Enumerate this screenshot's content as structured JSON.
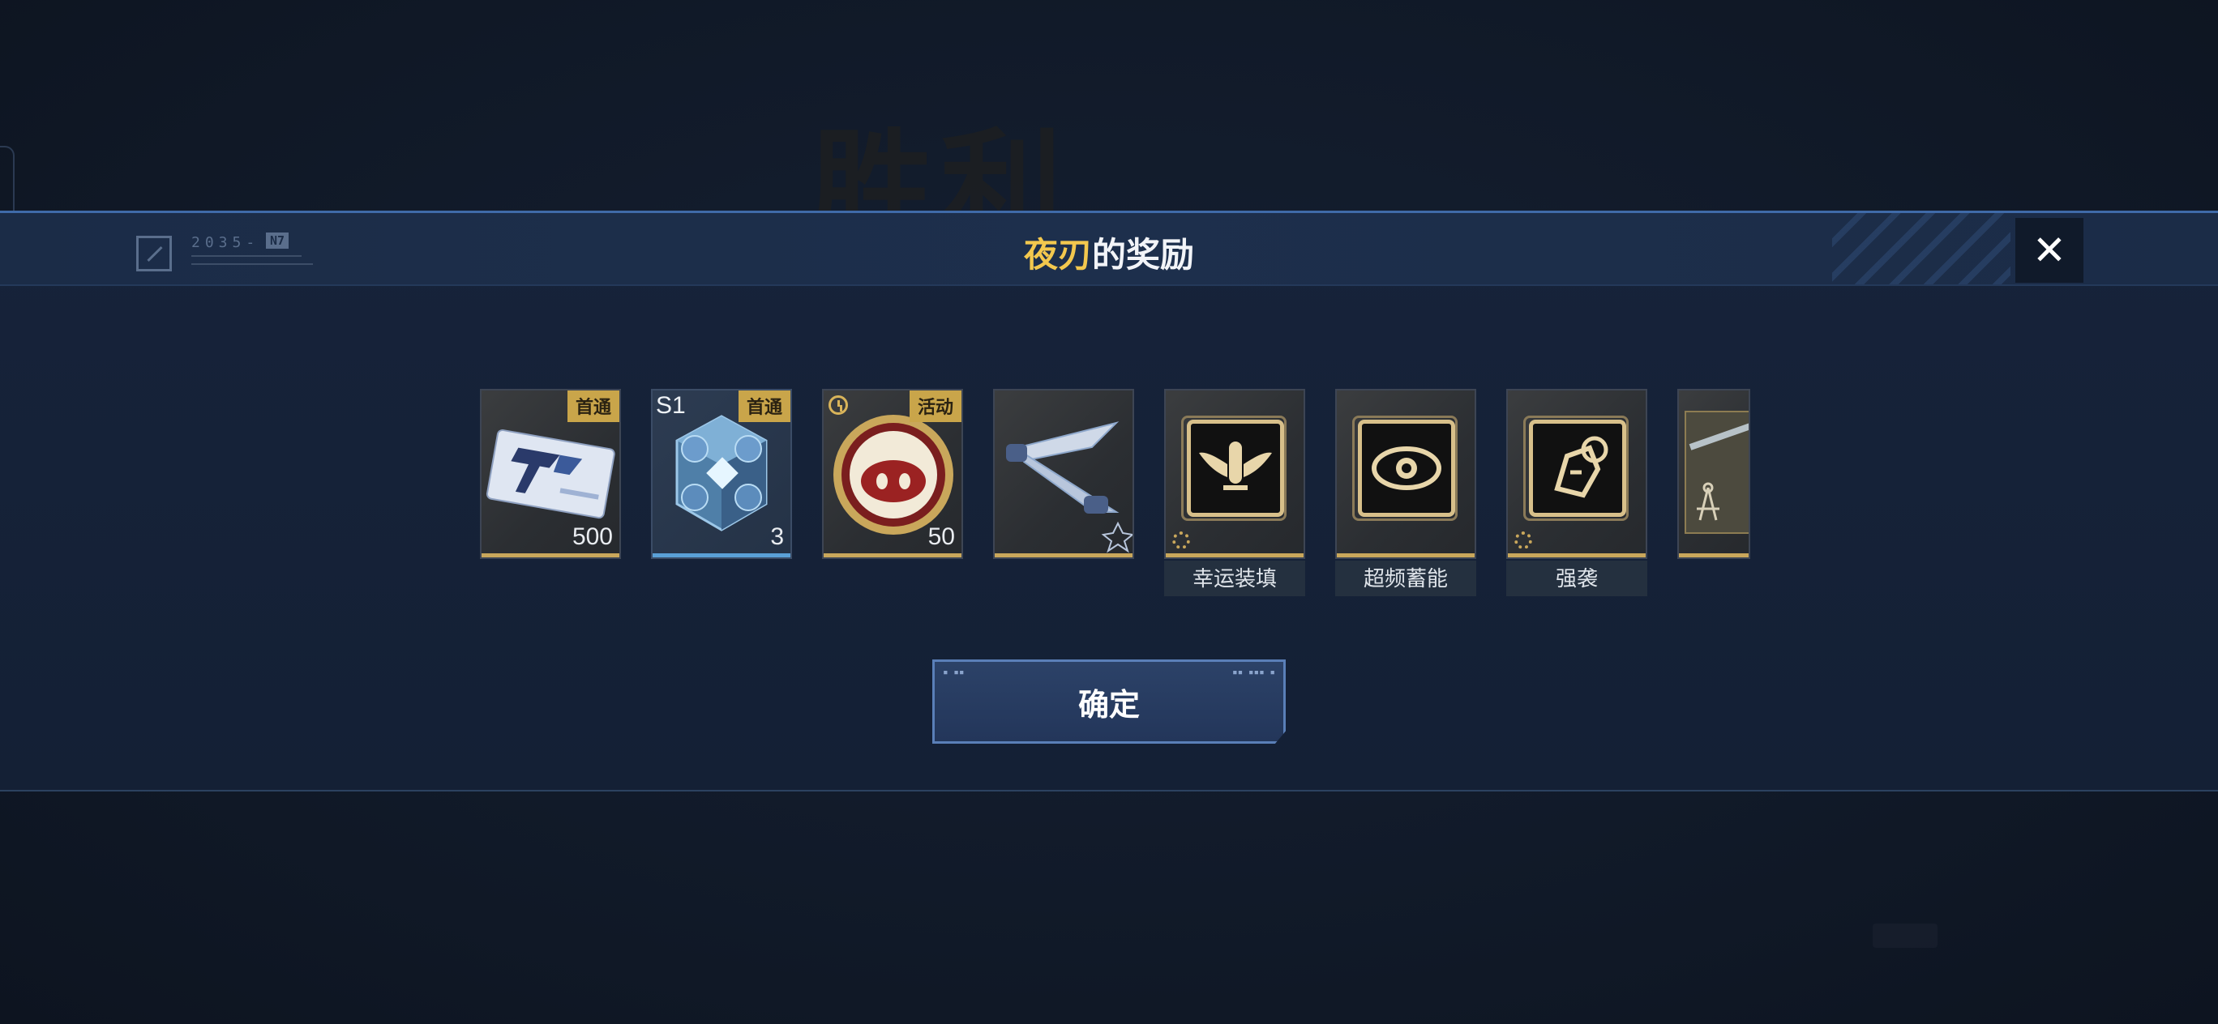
{
  "background": {
    "victory_text": "胜利"
  },
  "header": {
    "title_highlight": "夜刃",
    "title_rest": "的奖励",
    "deco_code": "2035-",
    "deco_tag": "N7",
    "close_symbol": "✕"
  },
  "rewards": [
    {
      "badge": "首通",
      "quantity": "500",
      "corner_text": "",
      "label": "",
      "icon": "ticket-item-icon",
      "rarity_color": "#c9a75b"
    },
    {
      "badge": "首通",
      "quantity": "3",
      "corner_text": "S1",
      "label": "",
      "icon": "crystal-cube-icon",
      "rarity_color": "#5aa0d6"
    },
    {
      "badge": "活动",
      "quantity": "50",
      "corner_text": "",
      "label": "",
      "icon": "pig-coin-icon",
      "rarity_color": "#c9a75b"
    },
    {
      "badge": "",
      "quantity": "",
      "corner_text": "",
      "label": "",
      "icon": "dual-blade-icon",
      "rarity_color": "#c9a75b"
    },
    {
      "badge": "",
      "quantity": "",
      "corner_text": "",
      "label": "幸运装填",
      "icon": "winged-bullet-icon",
      "rarity_color": "#c9a75b"
    },
    {
      "badge": "",
      "quantity": "",
      "corner_text": "",
      "label": "超频蓄能",
      "icon": "eye-emblem-icon",
      "rarity_color": "#c9a75b"
    },
    {
      "badge": "",
      "quantity": "",
      "corner_text": "",
      "label": "强袭",
      "icon": "bomb-emblem-icon",
      "rarity_color": "#c9a75b"
    },
    {
      "badge": "",
      "quantity": "",
      "corner_text": "",
      "label": "",
      "icon": "blueprint-icon",
      "rarity_color": "#c9a75b"
    }
  ],
  "confirm": {
    "label": "确定"
  },
  "colors": {
    "accent_gold": "#f3c84e",
    "band_border": "#3f6aa8",
    "badge_gold": "#c9a54a"
  }
}
